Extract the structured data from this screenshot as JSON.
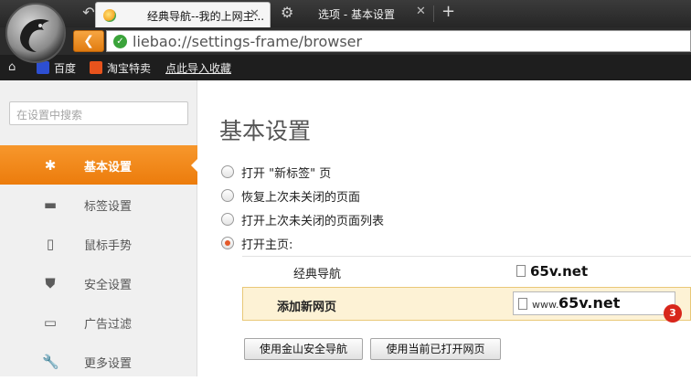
{
  "browser": {
    "tabs": [
      {
        "title": "经典导航--我的上网主..."
      },
      {
        "title": "选项 - 基本设置"
      }
    ],
    "close_glyph": "✕",
    "new_tab_glyph": "+",
    "url": "liebao://settings-frame/browser"
  },
  "bookmarks": [
    {
      "label": "百度",
      "icon": "baidu-paw-icon"
    },
    {
      "label": "淘宝特卖",
      "icon": "taobao-icon"
    },
    {
      "label": "点此导入收藏",
      "icon": ""
    }
  ],
  "sidebar": {
    "search_placeholder": "在设置中搜索",
    "items": [
      {
        "label": "基本设置",
        "icon": "gear-icon",
        "active": true
      },
      {
        "label": "标签设置",
        "icon": "laptop-icon",
        "active": false
      },
      {
        "label": "鼠标手势",
        "icon": "mouse-icon",
        "active": false
      },
      {
        "label": "安全设置",
        "icon": "shield-icon",
        "active": false
      },
      {
        "label": "广告过滤",
        "icon": "window-icon",
        "active": false
      },
      {
        "label": "更多设置",
        "icon": "wrench-icon",
        "active": false
      }
    ]
  },
  "main": {
    "title": "基本设置",
    "startup_options": [
      {
        "label": "打开 \"新标签\" 页",
        "selected": false
      },
      {
        "label": "恢复上次未关闭的页面",
        "selected": false
      },
      {
        "label": "打开上次未关闭的页面列表",
        "selected": false
      },
      {
        "label": "打开主页:",
        "selected": true
      }
    ],
    "homepages": [
      {
        "name": "经典导航",
        "url": "65v.net"
      },
      {
        "name": "添加新网页",
        "url_prefix": "www.",
        "url_domain": "65v.net"
      }
    ],
    "badge": "3",
    "buttons": [
      "使用金山安全导航",
      "使用当前已打开网页"
    ]
  },
  "colors": {
    "accent": "#ec7c0c",
    "badge": "#d8261b",
    "highlight_row": "#fdf2d5"
  }
}
